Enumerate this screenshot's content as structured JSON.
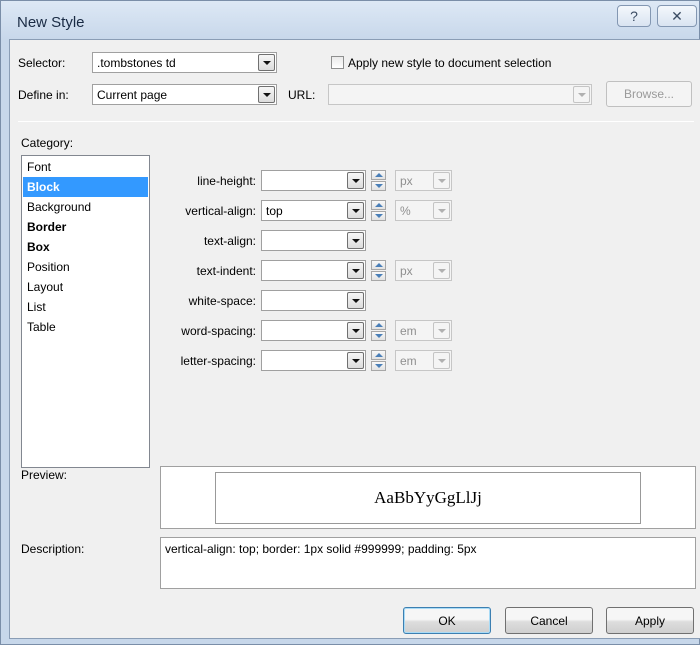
{
  "window": {
    "title": "New Style",
    "help_glyph": "?",
    "close_glyph": "✕"
  },
  "selector": {
    "label": "Selector:",
    "value": ".tombstones td",
    "apply_checkbox_label": "Apply new style to document selection",
    "apply_checked": false
  },
  "define_in": {
    "label": "Define in:",
    "value": "Current page",
    "url_label": "URL:",
    "url_value": "",
    "browse_label": "Browse..."
  },
  "category": {
    "label": "Category:",
    "items": [
      {
        "label": "Font",
        "selected": false,
        "bold": false
      },
      {
        "label": "Block",
        "selected": true,
        "bold": true
      },
      {
        "label": "Background",
        "selected": false,
        "bold": false
      },
      {
        "label": "Border",
        "selected": false,
        "bold": true
      },
      {
        "label": "Box",
        "selected": false,
        "bold": true
      },
      {
        "label": "Position",
        "selected": false,
        "bold": false
      },
      {
        "label": "Layout",
        "selected": false,
        "bold": false
      },
      {
        "label": "List",
        "selected": false,
        "bold": false
      },
      {
        "label": "Table",
        "selected": false,
        "bold": false
      }
    ]
  },
  "properties": {
    "line_height": {
      "label": "line-height:",
      "value": "",
      "unit": "px"
    },
    "vertical_align": {
      "label": "vertical-align:",
      "value": "top",
      "unit": "%"
    },
    "text_align": {
      "label": "text-align:",
      "value": ""
    },
    "text_indent": {
      "label": "text-indent:",
      "value": "",
      "unit": "px"
    },
    "white_space": {
      "label": "white-space:",
      "value": ""
    },
    "word_spacing": {
      "label": "word-spacing:",
      "value": "",
      "unit": "em"
    },
    "letter_spacing": {
      "label": "letter-spacing:",
      "value": "",
      "unit": "em"
    }
  },
  "preview": {
    "label": "Preview:",
    "sample_text": "AaBbYyGgLlJj"
  },
  "description": {
    "label": "Description:",
    "text": "vertical-align: top; border: 1px solid #999999; padding: 5px"
  },
  "buttons": {
    "ok": "OK",
    "cancel": "Cancel",
    "apply": "Apply"
  },
  "colors": {
    "selection": "#3399ff",
    "preview_border": "#999999"
  }
}
